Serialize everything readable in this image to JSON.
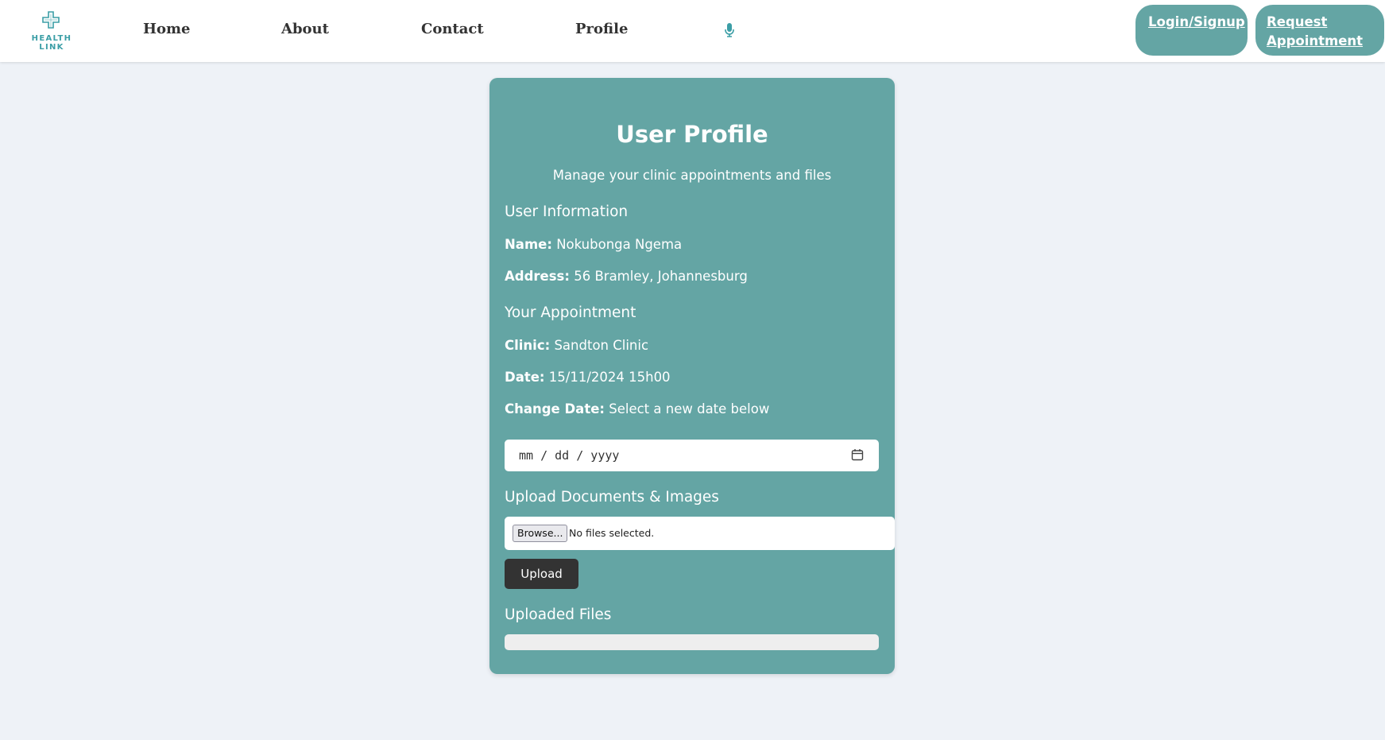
{
  "brand": {
    "logo_text": "HEALTH LINK",
    "accent": "#3b9ea6"
  },
  "nav": {
    "links": [
      "Home",
      "About",
      "Contact",
      "Profile"
    ],
    "login_label": "Login/Signup",
    "request_label_line1": "Request",
    "request_label_line2": "Appointment",
    "button_color": "#64a5a4"
  },
  "profile": {
    "title": "User Profile",
    "subtitle": "Manage your clinic appointments and files",
    "user_info_heading": "User Information",
    "name_label": "Name:",
    "name_value": "Nokubonga Ngema",
    "address_label": "Address:",
    "address_value": "56 Bramley, Johannesburg",
    "appointment_heading": "Your Appointment",
    "clinic_label": "Clinic:",
    "clinic_value": "Sandton Clinic",
    "date_label": "Date:",
    "date_value": "15/11/2024 15h00",
    "change_date_label": "Change Date:",
    "change_date_value": "Select a new date below",
    "date_placeholder": "mm / dd / yyyy",
    "upload_heading": "Upload Documents & Images",
    "browse_label": "Browse...",
    "file_status": "No files selected.",
    "upload_button": "Upload",
    "uploaded_files_heading": "Uploaded Files",
    "card_color": "#64a5a4"
  }
}
